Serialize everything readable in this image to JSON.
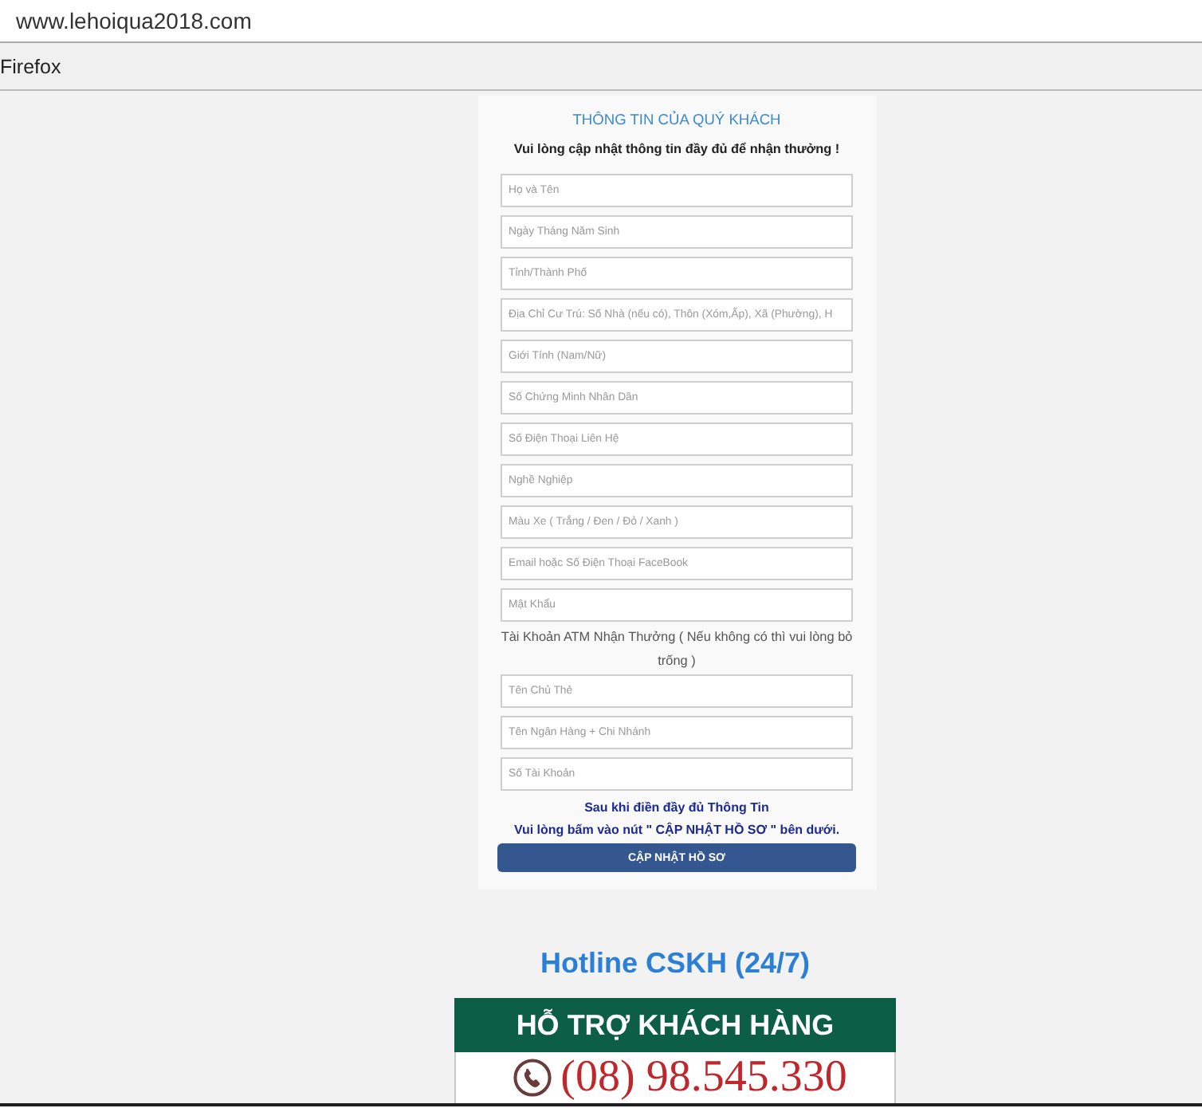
{
  "browser": {
    "url": "www.lehoiqua2018.com",
    "toolbar_label": "Firefox"
  },
  "form": {
    "title": "THÔNG TIN CỦA QUÝ KHÁCH",
    "subtitle": "Vui lòng cập nhật thông tin đầy đủ để nhận thưởng !",
    "fields": [
      {
        "placeholder": "Họ và Tên"
      },
      {
        "placeholder": "Ngày Tháng Năm Sinh"
      },
      {
        "placeholder": "Tỉnh/Thành Phố"
      },
      {
        "placeholder": "Địa Chỉ Cư Trú: Số Nhà (nếu có), Thôn (Xóm,Ấp), Xã (Phường), H"
      },
      {
        "placeholder": "Giới Tính (Nam/Nữ)"
      },
      {
        "placeholder": "Số Chứng Minh Nhân Dân"
      },
      {
        "placeholder": "Số Điện Thoại Liên Hệ"
      },
      {
        "placeholder": "Nghề Nghiệp"
      },
      {
        "placeholder": "Màu Xe ( Trắng / Đen / Đỏ / Xanh )"
      },
      {
        "placeholder": "Email hoặc Số Điện Thoại FaceBook"
      },
      {
        "placeholder": "Mật Khẩu"
      }
    ],
    "section_label": "Tài Khoản ATM Nhận Thưởng ( Nếu không có thì vui lòng bỏ trống )",
    "bank_fields": [
      {
        "placeholder": "Tên Chủ Thẻ"
      },
      {
        "placeholder": "Tên Ngân Hàng + Chi Nhánh"
      },
      {
        "placeholder": "Số Tài Khoản"
      }
    ],
    "notice": [
      "Sau khi điền đầy đủ Thông Tin",
      "Vui lòng bấm vào nút \" CẬP NHẬT HỒ SƠ \" bên dưới."
    ],
    "submit_button": "CẬP NHẬT HỒ SƠ"
  },
  "hotline": {
    "heading": "Hotline CSKH (24/7)",
    "banner": "HỖ TRỢ KHÁCH HÀNG",
    "phone": "(08) 98.545.330"
  }
}
